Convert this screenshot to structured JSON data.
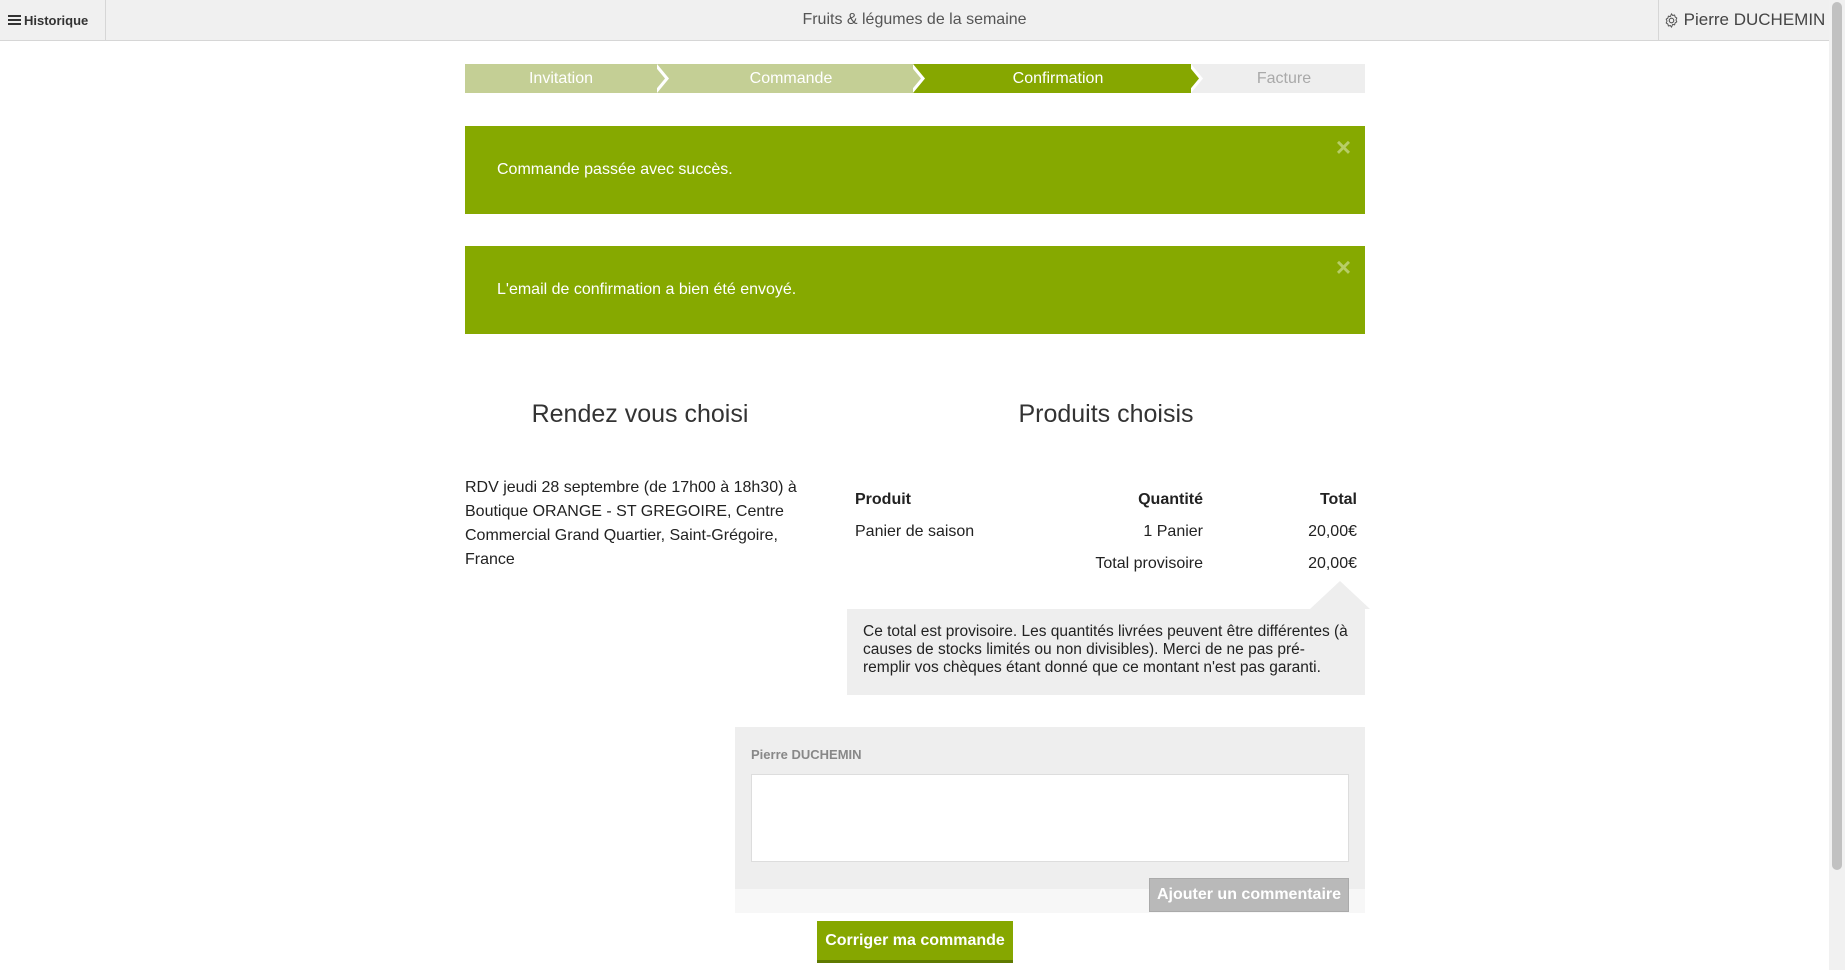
{
  "topbar": {
    "history_label": "Historique",
    "title": "Fruits & légumes de la semaine",
    "user_name": "Pierre DUCHEMIN"
  },
  "steps": [
    "Invitation",
    "Commande",
    "Confirmation",
    "Facture"
  ],
  "alerts": {
    "order_success": "Commande passée avec succès.",
    "email_sent": "L'email de confirmation a bien été envoyé.",
    "close_symbol": "×"
  },
  "rdv": {
    "heading": "Rendez vous choisi",
    "text": "RDV jeudi 28 septembre (de 17h00 à 18h30) à Boutique ORANGE - ST GREGOIRE, Centre Commercial Grand Quartier, Saint-Grégoire, France"
  },
  "products": {
    "heading": "Produits choisis",
    "columns": [
      "Produit",
      "Quantité",
      "Total"
    ],
    "rows": [
      {
        "product": "Panier de saison",
        "quantity": "1 Panier",
        "total": "20,00€"
      }
    ],
    "subtotal_label": "Total provisoire",
    "subtotal_value": "20,00€",
    "note": "Ce total est provisoire. Les quantités livrées peuvent être différentes (à causes de stocks limités ou non divisibles). Merci de ne pas pré-remplir vos chèques étant donné que ce montant n'est pas garanti."
  },
  "comment": {
    "author": "Pierre DUCHEMIN",
    "value": "",
    "add_label": "Ajouter un commentaire"
  },
  "actions": {
    "fix_order_label": "Corriger ma commande"
  },
  "colors": {
    "accent": "#86a700",
    "step_done": "#c4cf95",
    "step_future": "#eeeeee"
  }
}
